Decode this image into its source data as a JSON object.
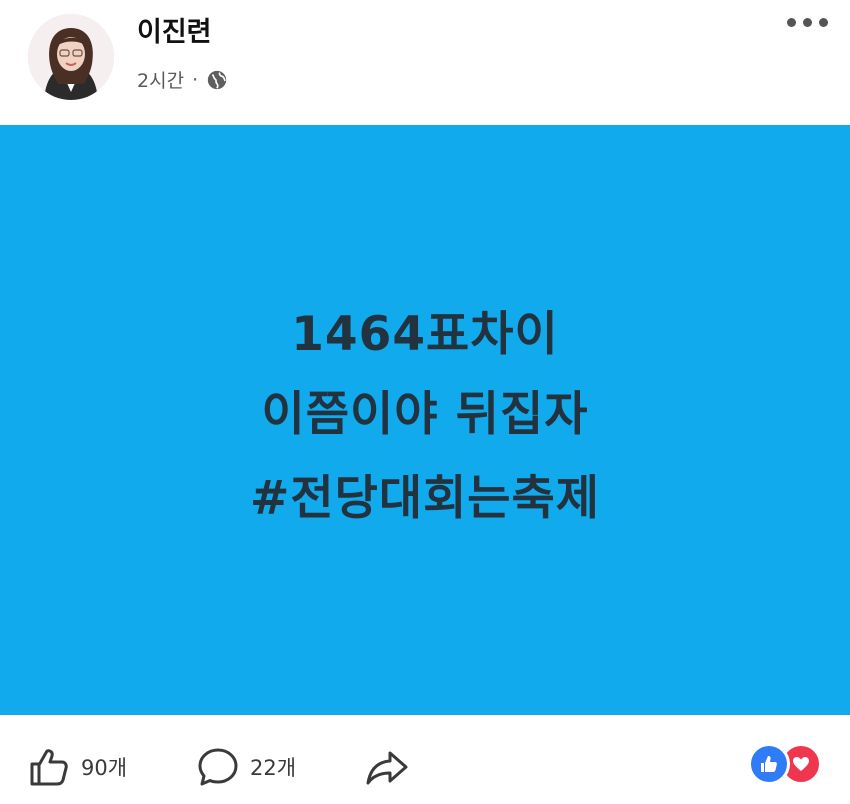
{
  "post": {
    "author": "이진련",
    "time": "2시간",
    "separator": "·",
    "privacy_icon": "globe-icon",
    "more_icon": "more-dots-icon",
    "image": {
      "background": "#11aaed",
      "text_color": "#22323f",
      "line1": "1464표차이",
      "line2": "이쯤이야 뒤집자",
      "hashtag_symbol": "#",
      "hashtag_word": "전당대회는축제"
    }
  },
  "actions": {
    "like_count": "90개",
    "comment_count": "22개",
    "like_icon": "thumbs-up-icon",
    "comment_icon": "comment-bubble-icon",
    "share_icon": "share-arrow-icon"
  },
  "reactions": {
    "icons": [
      "like-reaction-icon",
      "love-reaction-icon"
    ],
    "colors": {
      "like": "#2f7cf6",
      "love": "#f0354f"
    }
  }
}
